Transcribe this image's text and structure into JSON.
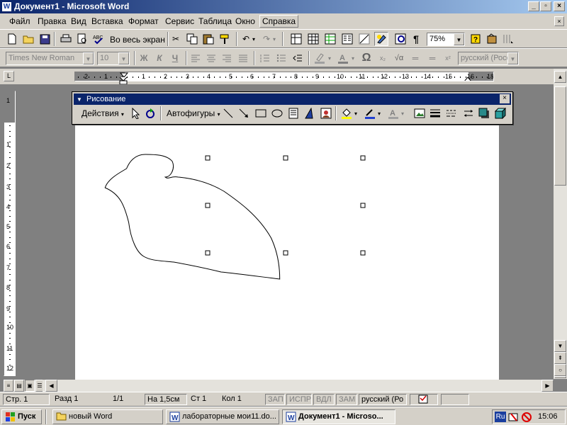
{
  "window": {
    "title": "Документ1 - Microsoft Word",
    "app_icon": "W"
  },
  "menu": {
    "items": [
      "Файл",
      "Правка",
      "Вид",
      "Вставка",
      "Формат",
      "Сервис",
      "Таблица",
      "Окно",
      "Справка"
    ]
  },
  "standard_toolbar": {
    "full_screen_label": "Во весь экран",
    "zoom_value": "75%"
  },
  "formatting_toolbar": {
    "font": "Times New Roman",
    "size": "10",
    "bold": "Ж",
    "italic": "К",
    "underline": "Ч",
    "language": "русский (Росс"
  },
  "ruler": {
    "labels": [
      "2",
      "1",
      "1",
      "2",
      "3",
      "4",
      "5",
      "6",
      "7",
      "8",
      "9",
      "10",
      "11",
      "12",
      "13",
      "14",
      "15",
      "16",
      "18"
    ],
    "corner": "L"
  },
  "vruler": {
    "labels": [
      "1",
      "1",
      "2",
      "3",
      "4",
      "5",
      "6",
      "7",
      "8",
      "9",
      "10",
      "11",
      "12"
    ]
  },
  "drawing_toolbar": {
    "title": "Рисование",
    "actions_label": "Действия",
    "autoshapes_label": "Автофигуры"
  },
  "status": {
    "page": "Стр. 1",
    "section": "Разд 1",
    "pages": "1/1",
    "at": "На 1,5см",
    "line": "Ст 1",
    "col": "Кол 1",
    "rec": "ЗАП",
    "trk": "ИСПР",
    "ext": "ВДЛ",
    "ovr": "ЗАМ",
    "language": "русский (Ро"
  },
  "taskbar": {
    "start_label": "Пуск",
    "tasks": [
      {
        "label": "новый Word",
        "icon": "folder-icon"
      },
      {
        "label": "лабораторные мои11.do...",
        "icon": "word-icon"
      },
      {
        "label": "Документ1 - Microso...",
        "icon": "word-icon",
        "active": true
      }
    ],
    "tray": {
      "lang": "Ru",
      "clock": "15:06"
    }
  },
  "colors": {
    "titlebar_start": "#0a246a",
    "titlebar_end": "#a6caf0",
    "face": "#d4d0c8",
    "workspace": "#808080"
  }
}
